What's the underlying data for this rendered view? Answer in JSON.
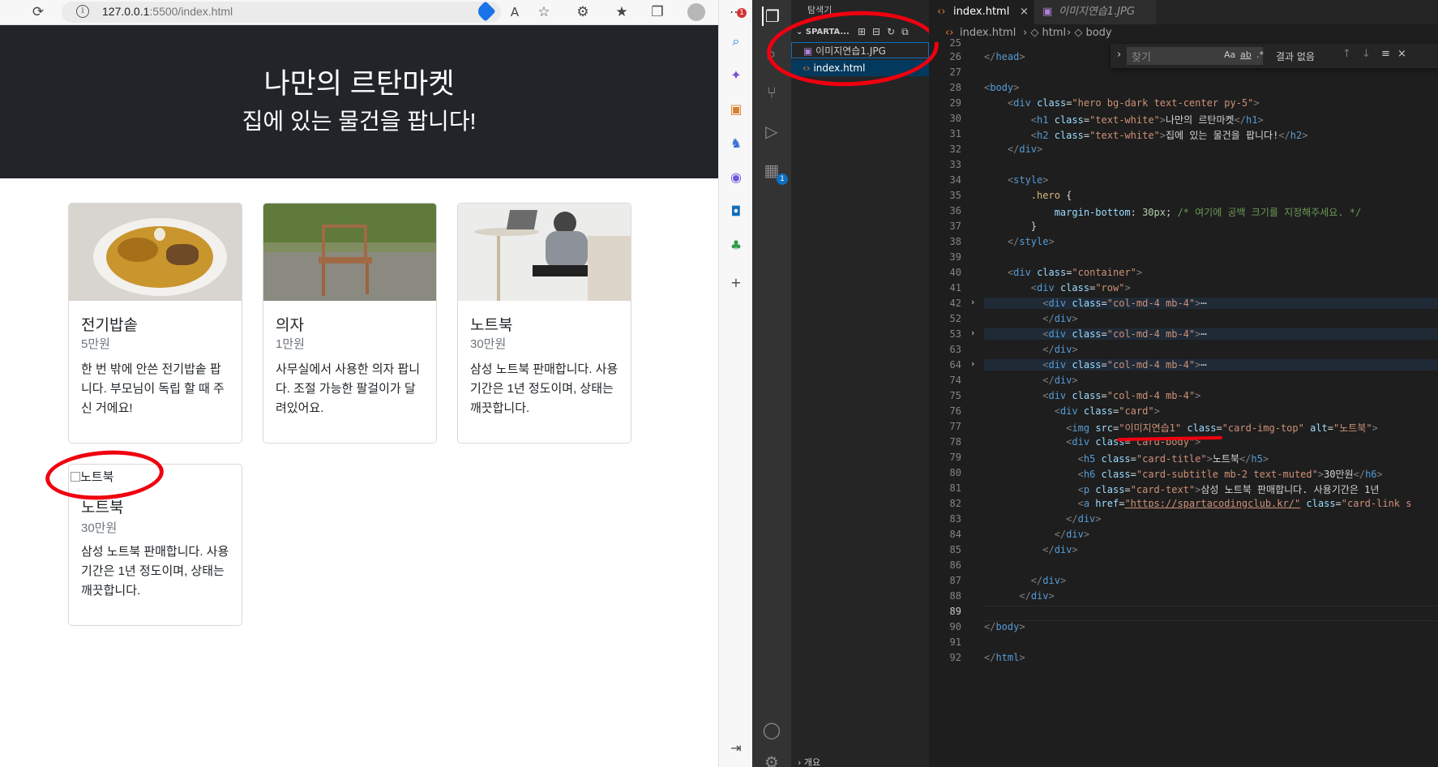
{
  "browser": {
    "url_host": "127.0.0.1",
    "url_rest": ":5500/index.html",
    "badge": "1",
    "icons": [
      "reload-icon",
      "info-icon",
      "tag-icon",
      "read-aloud-icon",
      "add-favorite-icon",
      "extensions-icon",
      "favorites-icon",
      "collections-icon",
      "profile-icon",
      "more-icon"
    ]
  },
  "hero": {
    "title": "나만의 르탄마켓",
    "subtitle": "집에 있는 물건을 팝니다!"
  },
  "cards": [
    {
      "title": "전기밥솥",
      "price": "5만원",
      "text": "한 번 밖에 안쓴 전기밥솥 팝니다. 부모님이 독립 할 때 주신 거에요!"
    },
    {
      "title": "의자",
      "price": "1만원",
      "text": "사무실에서 사용한 의자 팝니다. 조절 가능한 팔걸이가 달려있어요."
    },
    {
      "title": "노트북",
      "price": "30만원",
      "text": "삼성 노트북 판매합니다. 사용기간은 1년 정도이며, 상태는 깨끗합니다."
    },
    {
      "title": "노트북",
      "price": "30만원",
      "text": "삼성 노트북 판매합니다. 사용기간은 1년 정도이며, 상태는 깨끗합니다.",
      "img_alt": "노트북"
    }
  ],
  "editor": {
    "tabs": [
      {
        "label": "탐색기"
      },
      {
        "label": "index.html"
      },
      {
        "label": "이미지연습1.JPG"
      }
    ],
    "explorer_title": "SPARTA...",
    "files": [
      "이미지연습1.JPG",
      "index.html"
    ],
    "outline_label": "개요",
    "breadcrumb": [
      "index.html",
      "html",
      "body"
    ],
    "find_placeholder": "찾기",
    "find_result": "결과 없음",
    "find_opts": [
      "Aa",
      "ab",
      ".*"
    ],
    "activity_badge": "1"
  },
  "colors": {
    "hero_bg": "#212529",
    "editor_bg": "#1e1e1e",
    "annotation_red": "#f0000f"
  }
}
